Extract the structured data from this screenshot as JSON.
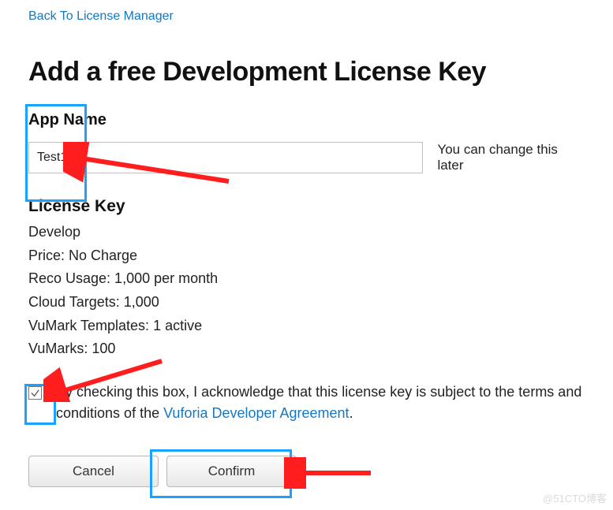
{
  "nav": {
    "back_link": "Back To License Manager"
  },
  "page": {
    "title": "Add a free Development License Key"
  },
  "app_name": {
    "label": "App Name",
    "value": "Test1",
    "hint": "You can change this later"
  },
  "license": {
    "heading": "License Key",
    "details": {
      "tier": "Develop",
      "price": "Price: No Charge",
      "reco_usage": "Reco Usage: 1,000 per month",
      "cloud_targets": "Cloud Targets: 1,000",
      "vumark_templates": "VuMark Templates: 1 active",
      "vumarks": "VuMarks: 100"
    }
  },
  "acknowledge": {
    "checked": true,
    "text_prefix": "By checking this box, I acknowledge that this license key is subject to the terms and conditions of the ",
    "agreement_text": "Vuforia Developer Agreement",
    "text_suffix": "."
  },
  "buttons": {
    "cancel": "Cancel",
    "confirm": "Confirm"
  },
  "watermark": "@51CTO博客"
}
